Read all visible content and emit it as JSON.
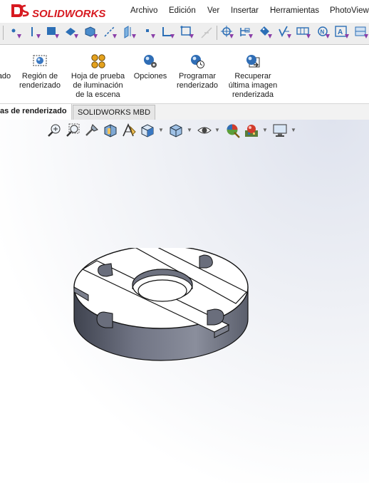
{
  "app": {
    "brand": "SOLIDWORKS",
    "brand_color": "#d71920"
  },
  "menu": [
    {
      "label": "Archivo"
    },
    {
      "label": "Edición"
    },
    {
      "label": "Ver"
    },
    {
      "label": "Insertar"
    },
    {
      "label": "Herramientas"
    },
    {
      "label": "PhotoView"
    }
  ],
  "filter_toolbar": {
    "icons": [
      "filter-vertex-icon",
      "filter-edge-icon",
      "filter-face-icon",
      "filter-surface-icon",
      "filter-solid-body-icon",
      "filter-axis-icon",
      "filter-plane-icon",
      "filter-point-icon",
      "filter-sketch-segment-icon",
      "filter-sketch-point-icon",
      "filter-disabled-icon",
      "filter-midpoint-icon",
      "filter-dimension-icon",
      "filter-tag-icon",
      "filter-surface-finish-icon",
      "filter-datum-icon",
      "filter-note-icon",
      "filter-annotation-icon"
    ]
  },
  "ribbon": {
    "buttons": [
      {
        "label_lines": [
          "ado",
          ""
        ],
        "icon": "render-icon"
      },
      {
        "label_lines": [
          "Región de",
          "renderizado",
          ""
        ],
        "icon": "render-region-icon"
      },
      {
        "label_lines": [
          "Hoja de prueba",
          "de iluminación",
          "de la escena"
        ],
        "icon": "scene-illumination-icon"
      },
      {
        "label_lines": [
          "Opciones",
          "",
          ""
        ],
        "icon": "options-icon"
      },
      {
        "label_lines": [
          "Programar",
          "renderizado",
          ""
        ],
        "icon": "schedule-render-icon"
      },
      {
        "label_lines": [
          "Recuperar",
          "última imagen",
          "renderizada"
        ],
        "icon": "recall-render-icon"
      }
    ]
  },
  "tabs": [
    {
      "label": "as de renderizado",
      "active": true
    },
    {
      "label": "SOLIDWORKS MBD",
      "active": false
    }
  ],
  "headsup_toolbar": {
    "icons": [
      "zoom-to-fit-icon",
      "zoom-to-area-icon",
      "previous-view-icon",
      "section-view-icon",
      "dynamic-annotation-icon",
      "view-orientation-icon",
      "display-style-icon",
      "hide-show-items-icon",
      "edit-appearance-icon",
      "apply-scene-icon",
      "view-settings-icon"
    ]
  },
  "model": {
    "top_color": "#ffffff",
    "side_color": "#6a6e7c",
    "edge_color": "#111111"
  }
}
